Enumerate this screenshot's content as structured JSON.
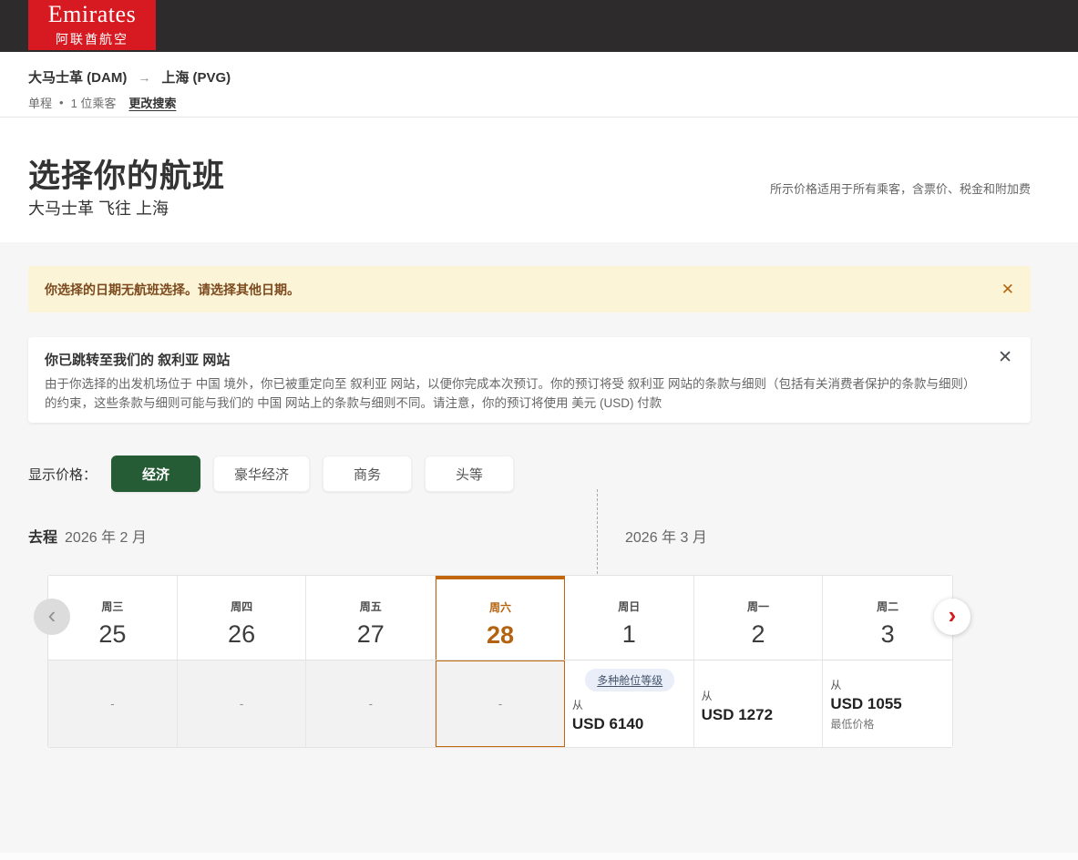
{
  "brand": {
    "name": "Emirates",
    "name_cn": "阿联酋航空"
  },
  "breadcrumb": {
    "origin": "大马士革 (DAM)",
    "arrow_icon": "→",
    "destination": "上海 (PVG)",
    "trip_type": "单程",
    "separator": "•",
    "passengers": "1 位乘客",
    "change_search": "更改搜索"
  },
  "page": {
    "title": "选择你的航班",
    "subtitle": "大马士革 飞往 上海",
    "price_note": "所示价格适用于所有乘客，含票价、税金和附加费"
  },
  "alert": {
    "message": "你选择的日期无航班选择。请选择其他日期。",
    "close_icon": "✕"
  },
  "notice": {
    "title": "你已跳转至我们的 叙利亚 网站",
    "body": "由于你选择的出发机场位于 中国 境外，你已被重定向至 叙利亚 网站，以便你完成本次预订。你的预订将受 叙利亚 网站的条款与细则（包括有关消费者保护的条款与细则）的约束，这些条款与细则可能与我们的 中国 网站上的条款与细则不同。请注意，你的预订将使用 美元 (USD) 付款",
    "close_icon": "✕"
  },
  "cabin_filter": {
    "label": "显示价格：",
    "options": [
      {
        "label": "经济",
        "selected": true
      },
      {
        "label": "豪华经济",
        "selected": false
      },
      {
        "label": "商务",
        "selected": false
      },
      {
        "label": "头等",
        "selected": false
      }
    ]
  },
  "calendar": {
    "direction_label": "去程",
    "month_left": "2026 年 2 月",
    "month_right": "2026 年 3 月",
    "prev_icon": "‹",
    "next_icon": "›",
    "days": [
      {
        "weekday": "周三",
        "date": "25",
        "empty": "-",
        "selected": false
      },
      {
        "weekday": "周四",
        "date": "26",
        "empty": "-",
        "selected": false
      },
      {
        "weekday": "周五",
        "date": "27",
        "empty": "-",
        "selected": false
      },
      {
        "weekday": "周六",
        "date": "28",
        "empty": "-",
        "selected": true
      },
      {
        "weekday": "周日",
        "date": "1",
        "badge": "多种舱位等级",
        "from_label": "从",
        "price": "USD 6140",
        "selected": false
      },
      {
        "weekday": "周一",
        "date": "2",
        "from_label": "从",
        "price": "USD 1272",
        "selected": false
      },
      {
        "weekday": "周二",
        "date": "3",
        "from_label": "从",
        "price": "USD 1055",
        "note": "最低价格",
        "selected": false
      }
    ]
  },
  "colors": {
    "brand_red": "#d71a21",
    "topbar": "#2e2b2c",
    "selected_green": "#265c35",
    "selection_orange": "#c2660d",
    "alert_bg": "#fbf4d6",
    "alert_text": "#7c4a1e",
    "page_bg": "#f6f6f6"
  }
}
